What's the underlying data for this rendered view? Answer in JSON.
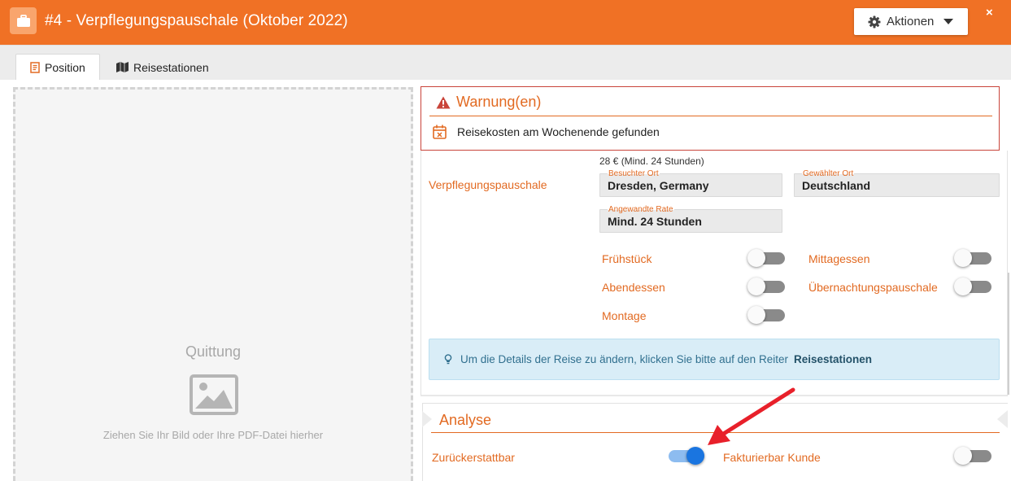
{
  "header": {
    "title": "#4 -  Verpflegungspauschale (Oktober 2022)",
    "icon": "briefcase-icon",
    "actions_label": "Aktionen",
    "close_label": "×",
    "color": "#f07125"
  },
  "tabs": [
    {
      "label": "Position",
      "icon": "receipt-icon",
      "active": true
    },
    {
      "label": "Reisestationen",
      "icon": "map-icon",
      "active": false
    }
  ],
  "dropzone": {
    "title": "Quittung",
    "hint": "Ziehen Sie Ihr Bild oder Ihre PDF-Datei hierher",
    "icon": "image-icon"
  },
  "warning": {
    "title": "Warnung(en)",
    "icon": "warning-triangle-icon",
    "items": [
      {
        "text": "Reisekosten am Wochenende gefunden",
        "icon": "calendar-x-icon"
      }
    ]
  },
  "verpflegung": {
    "label": "Verpflegungspauschale",
    "rate_note": "28 € (Mind. 24 Stunden)",
    "besuchter_ort": {
      "label": "Besuchter Ort",
      "value": "Dresden, Germany"
    },
    "gewaehlter_ort": {
      "label": "Gewählter Ort",
      "value": "Deutschland"
    },
    "angewandte_rate": {
      "label": "Angewandte Rate",
      "value": "Mind. 24 Stunden"
    }
  },
  "meals": {
    "fruehstueck": {
      "label": "Frühstück",
      "on": false
    },
    "mittagessen": {
      "label": "Mittagessen",
      "on": false
    },
    "abendessen": {
      "label": "Abendessen",
      "on": false
    },
    "uebernachtung": {
      "label": "Übernachtungspauschale",
      "on": false
    },
    "montage": {
      "label": "Montage",
      "on": false
    }
  },
  "info": {
    "text": "Um die Details der Reise zu ändern, klicken Sie bitte auf den Reiter",
    "link": "Reisestationen",
    "icon": "lightbulb-icon"
  },
  "analyse": {
    "title": "Analyse",
    "zurueckerstattbar": {
      "label": "Zurückerstattbar",
      "on": true
    },
    "fakturierbar": {
      "label": "Fakturierbar Kunde",
      "on": false
    }
  },
  "colors": {
    "accent": "#e26a22",
    "toggle_on": "#1a75e0",
    "info_bg": "#d9edf7",
    "warning_border": "#c9443a",
    "annotation_arrow": "#e8202a"
  }
}
